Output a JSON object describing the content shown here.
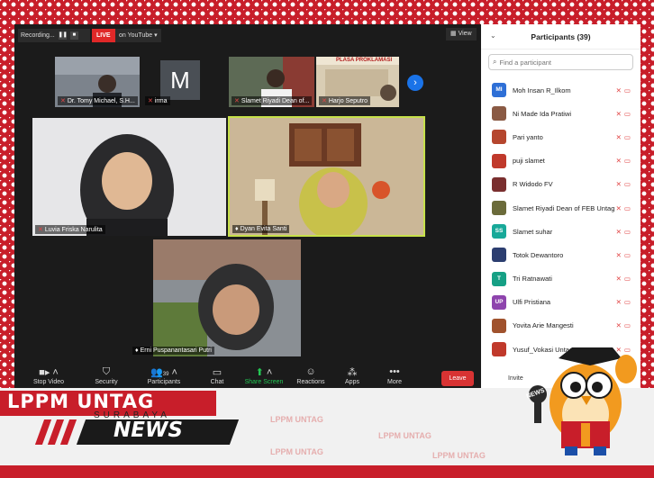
{
  "topbar": {
    "recording_label": "Recording...",
    "live_label": "LIVE",
    "stream_target": "on YouTube",
    "view_label": "View"
  },
  "thumbnails": [
    {
      "name": "Dr. Tomy Michael, S.H..."
    },
    {
      "name": "irma",
      "initial": "M"
    },
    {
      "name": "Slamet Riyadi Dean of..."
    },
    {
      "name": "Harjo Seputro",
      "banner": "PLASA PROKLAMASI"
    }
  ],
  "gallery": [
    {
      "name": "Luvia Friska Narulita"
    },
    {
      "name": "Dyan Evita Santi"
    },
    {
      "name": "Erni Puspanantasari Putri"
    }
  ],
  "toolbar": {
    "stop_video": "Stop Video",
    "security": "Security",
    "participants": "Participants",
    "participants_count": "39",
    "chat": "Chat",
    "share_screen": "Share Screen",
    "reactions": "Reactions",
    "apps": "Apps",
    "more": "More",
    "leave": "Leave"
  },
  "panel": {
    "title": "Participants (39)",
    "search_placeholder": "Find a participant",
    "invite_label": "Invite",
    "participants": [
      {
        "name": "Moh Insan R_Ilkom",
        "initials": "MI",
        "color": "#2e6fd6"
      },
      {
        "name": "Ni Made Ida Pratiwi",
        "initials": "",
        "color": "#8a5a44"
      },
      {
        "name": "Pari yanto",
        "initials": "",
        "color": "#b5462e"
      },
      {
        "name": "puji slamet",
        "initials": "",
        "color": "#c0392b"
      },
      {
        "name": "R Widodo FV",
        "initials": "",
        "color": "#7a2f2f"
      },
      {
        "name": "Slamet Riyadi Dean of FEB Untag",
        "initials": "",
        "color": "#6b6b3a"
      },
      {
        "name": "Slamet suhar",
        "initials": "SS",
        "color": "#18a999"
      },
      {
        "name": "Totok Dewantoro",
        "initials": "",
        "color": "#2c3e70"
      },
      {
        "name": "Tri Ratnawati",
        "initials": "T",
        "color": "#16a085"
      },
      {
        "name": "Ulfi Pristiana",
        "initials": "UP",
        "color": "#8e44ad"
      },
      {
        "name": "Yovita Arie Mangesti",
        "initials": "",
        "color": "#a0522d"
      },
      {
        "name": "Yusuf_Vokasi Untag",
        "initials": "",
        "color": "#c0392b"
      }
    ]
  },
  "banner": {
    "lppm_text": "LPPM UNTAG",
    "city_text": "SURABAYA",
    "news_text": "NEWS",
    "mascot_mic_text": "NEWS",
    "watermark_text": "LPPM UNTAG"
  }
}
